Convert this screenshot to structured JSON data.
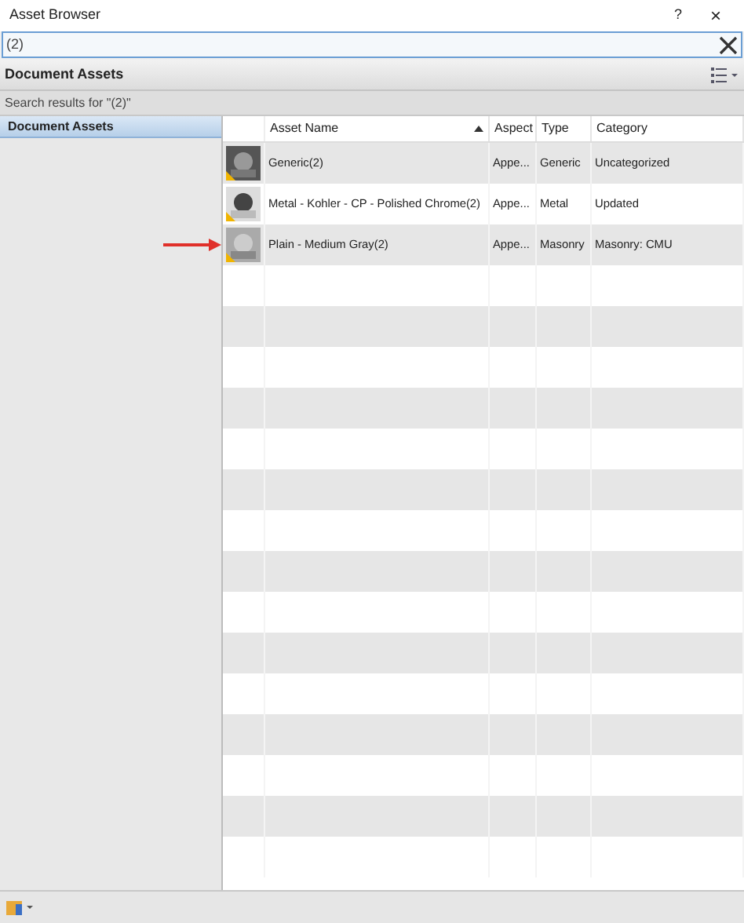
{
  "window": {
    "title": "Asset Browser",
    "help": "?",
    "close": "×"
  },
  "search": {
    "value": "(2)"
  },
  "header": {
    "title": "Document Assets"
  },
  "results_label": "Search results for \"(2)\"",
  "sidebar": {
    "items": [
      {
        "label": "Document Assets",
        "selected": true
      }
    ]
  },
  "table": {
    "columns": [
      {
        "label": "Asset Name",
        "sorted": true
      },
      {
        "label": "Aspect",
        "sorted": false
      },
      {
        "label": "Type",
        "sorted": false
      },
      {
        "label": "Category",
        "sorted": false
      }
    ],
    "rows": [
      {
        "kind": "generic",
        "name": "Generic(2)",
        "aspect": "Appe...",
        "type": "Generic",
        "category": "Uncategorized"
      },
      {
        "kind": "metal",
        "name": "Metal - Kohler - CP - Polished Chrome(2)",
        "aspect": "Appe...",
        "type": "Metal",
        "category": "Updated"
      },
      {
        "kind": "masonry",
        "name": "Plain - Medium Gray(2)",
        "aspect": "Appe...",
        "type": "Masonry",
        "category": "Masonry: CMU"
      }
    ]
  }
}
